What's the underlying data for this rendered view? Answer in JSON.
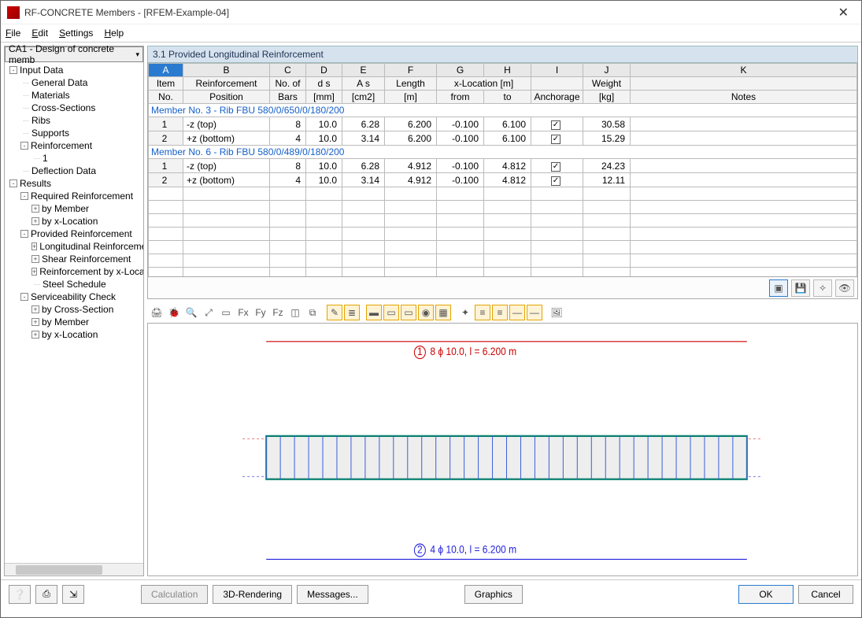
{
  "window": {
    "title": "RF-CONCRETE Members - [RFEM-Example-04]"
  },
  "menubar": [
    "File",
    "Edit",
    "Settings",
    "Help"
  ],
  "left": {
    "combo": "CA1 - Design of concrete memb",
    "tree": [
      {
        "lvl": 1,
        "toggle": "-",
        "label": "Input Data"
      },
      {
        "lvl": 2,
        "leaf": true,
        "label": "General Data"
      },
      {
        "lvl": 2,
        "leaf": true,
        "label": "Materials"
      },
      {
        "lvl": 2,
        "leaf": true,
        "label": "Cross-Sections"
      },
      {
        "lvl": 2,
        "leaf": true,
        "label": "Ribs"
      },
      {
        "lvl": 2,
        "leaf": true,
        "label": "Supports"
      },
      {
        "lvl": 2,
        "toggle": "-",
        "label": "Reinforcement"
      },
      {
        "lvl": 3,
        "leaf": true,
        "label": "1"
      },
      {
        "lvl": 2,
        "leaf": true,
        "label": "Deflection Data"
      },
      {
        "lvl": 1,
        "toggle": "-",
        "label": "Results"
      },
      {
        "lvl": 2,
        "toggle": "-",
        "label": "Required Reinforcement"
      },
      {
        "lvl": 3,
        "toggle": "+",
        "label": "by Member"
      },
      {
        "lvl": 3,
        "toggle": "+",
        "label": "by x-Location"
      },
      {
        "lvl": 2,
        "toggle": "-",
        "label": "Provided Reinforcement"
      },
      {
        "lvl": 3,
        "toggle": "+",
        "label": "Longitudinal Reinforcement"
      },
      {
        "lvl": 3,
        "toggle": "+",
        "label": "Shear Reinforcement"
      },
      {
        "lvl": 3,
        "toggle": "+",
        "label": "Reinforcement by x-Location"
      },
      {
        "lvl": 3,
        "leaf": true,
        "label": "Steel Schedule"
      },
      {
        "lvl": 2,
        "toggle": "-",
        "label": "Serviceability Check"
      },
      {
        "lvl": 3,
        "toggle": "+",
        "label": "by Cross-Section"
      },
      {
        "lvl": 3,
        "toggle": "+",
        "label": "by Member"
      },
      {
        "lvl": 3,
        "toggle": "+",
        "label": "by x-Location"
      }
    ]
  },
  "panel": {
    "title": "3.1 Provided Longitudinal Reinforcement",
    "col_letters": [
      "A",
      "B",
      "C",
      "D",
      "E",
      "F",
      "G",
      "H",
      "I",
      "J",
      "K"
    ],
    "header_row1": [
      "Item",
      "Reinforcement",
      "No. of",
      "d s",
      "A s",
      "Length",
      "x-Location [m]",
      "",
      "",
      "Weight",
      ""
    ],
    "header_row2": [
      "No.",
      "Position",
      "Bars",
      "[mm]",
      "[cm2]",
      "[m]",
      "from",
      "to",
      "Anchorage",
      "[kg]",
      "Notes"
    ],
    "sections": [
      {
        "title": "Member No. 3  -  Rib FBU 580/0/650/0/180/200",
        "rows": [
          {
            "item": "1",
            "pos": "-z (top)",
            "bars": "8",
            "ds": "10.0",
            "as": "6.28",
            "len": "6.200",
            "from": "-0.100",
            "to": "6.100",
            "anch": true,
            "wt": "30.58",
            "notes": ""
          },
          {
            "item": "2",
            "pos": "+z (bottom)",
            "bars": "4",
            "ds": "10.0",
            "as": "3.14",
            "len": "6.200",
            "from": "-0.100",
            "to": "6.100",
            "anch": true,
            "wt": "15.29",
            "notes": ""
          }
        ]
      },
      {
        "title": "Member No. 6  -  Rib FBU 580/0/489/0/180/200",
        "rows": [
          {
            "item": "1",
            "pos": "-z (top)",
            "bars": "8",
            "ds": "10.0",
            "as": "6.28",
            "len": "4.912",
            "from": "-0.100",
            "to": "4.812",
            "anch": true,
            "wt": "24.23",
            "notes": ""
          },
          {
            "item": "2",
            "pos": "+z (bottom)",
            "bars": "4",
            "ds": "10.0",
            "as": "3.14",
            "len": "4.912",
            "from": "-0.100",
            "to": "4.812",
            "anch": true,
            "wt": "12.11",
            "notes": ""
          }
        ]
      }
    ]
  },
  "gfx_labels": {
    "top": "8 ϕ 10.0, l = 6.200 m",
    "top_badge": "1",
    "bottom": "4 ϕ 10.0, l = 6.200 m",
    "bottom_badge": "2"
  },
  "bottom": {
    "calculation": "Calculation",
    "rendering": "3D-Rendering",
    "messages": "Messages...",
    "graphics": "Graphics",
    "ok": "OK",
    "cancel": "Cancel"
  },
  "icon_row": [
    "image-icon",
    "disk-icon",
    "wand-icon",
    "eye-icon"
  ],
  "toolbar_icons": [
    "print-icon",
    "bug-icon",
    "zoom-icon",
    "zoom-fit-icon",
    "selection-icon",
    "axis-x-icon",
    "axis-y-icon",
    "axis-z-icon",
    "cube-icon",
    "copy-icon",
    "divider",
    "pencil-icon",
    "layers-icon",
    "divider",
    "fill-icon",
    "rect1-icon",
    "rect2-icon",
    "rect3-icon",
    "grid-icon",
    "divider",
    "axis-icon",
    "span1-icon",
    "span2-icon",
    "span3-icon",
    "span4-icon",
    "divider",
    "picture-icon"
  ]
}
